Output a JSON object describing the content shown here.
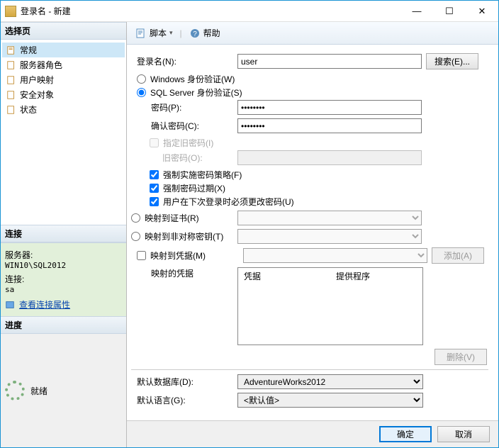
{
  "window": {
    "title": "登录名 - 新建"
  },
  "winbtns": {
    "min": "—",
    "max": "☐",
    "close": "✕"
  },
  "left": {
    "select_page": "选择页",
    "nav": [
      {
        "label": "常规"
      },
      {
        "label": "服务器角色"
      },
      {
        "label": "用户映射"
      },
      {
        "label": "安全对象"
      },
      {
        "label": "状态"
      }
    ],
    "conn": {
      "title": "连接",
      "server_label": "服务器:",
      "server_value": "WIN10\\SQL2012",
      "conn_label": "连接:",
      "conn_value": "sa",
      "view_props": "查看连接属性"
    },
    "progress": {
      "title": "进度",
      "status": "就绪"
    }
  },
  "toolbar": {
    "script": "脚本",
    "help": "帮助"
  },
  "form": {
    "login_label": "登录名(N):",
    "login_value": "user",
    "search_btn": "搜索(E)...",
    "auth_win": "Windows 身份验证(W)",
    "auth_sql": "SQL Server 身份验证(S)",
    "pwd_label": "密码(P):",
    "pwd_value": "••••••••",
    "pwd2_label": "确认密码(C):",
    "pwd2_value": "••••••••",
    "spec_old": "指定旧密码(I)",
    "old_pwd": "旧密码(O):",
    "enforce_policy": "强制实施密码策略(F)",
    "enforce_expiry": "强制密码过期(X)",
    "must_change": "用户在下次登录时必须更改密码(U)",
    "map_cert": "映射到证书(R)",
    "map_asym": "映射到非对称密钥(T)",
    "map_cred": "映射到凭据(M)",
    "add_btn": "添加(A)",
    "mapped_creds": "映射的凭据",
    "col_cred": "凭据",
    "col_provider": "提供程序",
    "delete_btn": "删除(V)",
    "default_db_label": "默认数据库(D):",
    "default_db_value": "AdventureWorks2012",
    "default_lang_label": "默认语言(G):",
    "default_lang_value": "<默认值>"
  },
  "footer": {
    "ok": "确定",
    "cancel": "取消"
  }
}
